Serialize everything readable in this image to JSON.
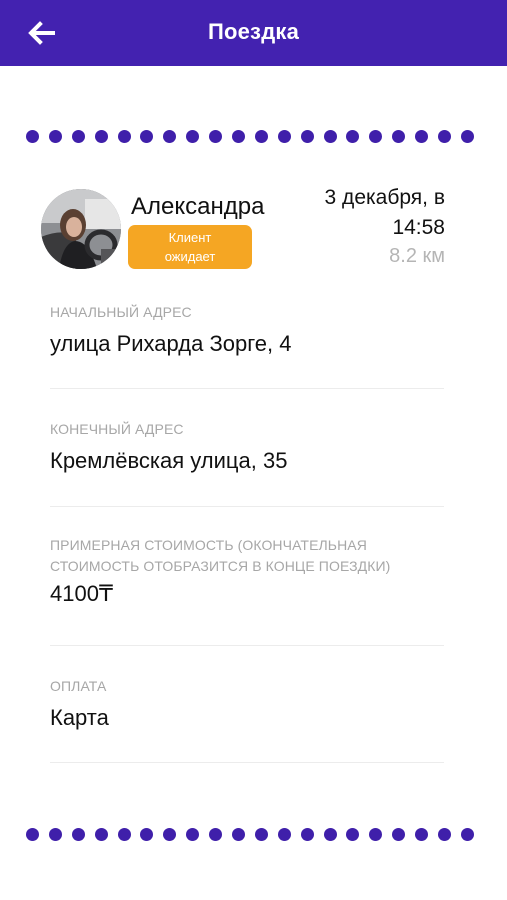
{
  "header": {
    "title": "Поездка",
    "back_icon": "arrow-left-icon",
    "background": "#4322B0"
  },
  "trip": {
    "client_name": "Александра",
    "status_line1": "Клиент",
    "status_line2": "ожидает",
    "status_color": "#F5A623",
    "date": "3 декабря, в",
    "time": "14:58",
    "distance": "8.2 км"
  },
  "fields": {
    "start": {
      "label": "НАЧАЛЬНЫЙ АДРЕС",
      "value": "улица Рихарда Зорге, 4"
    },
    "end": {
      "label": "КОНЕЧНЫЙ АДРЕС",
      "value": "Кремлёвская улица, 35"
    },
    "cost": {
      "label_line1": "ПРИМЕРНАЯ СТОИМОСТЬ (ОКОНЧАТЕЛЬНАЯ",
      "label_line2": "СТОИМОСТЬ ОТОБРАЗИТСЯ В КОНЦЕ ПОЕЗДКИ)",
      "value": "4100₸"
    },
    "payment": {
      "label": "ОПЛАТА",
      "value": "Карта"
    }
  }
}
